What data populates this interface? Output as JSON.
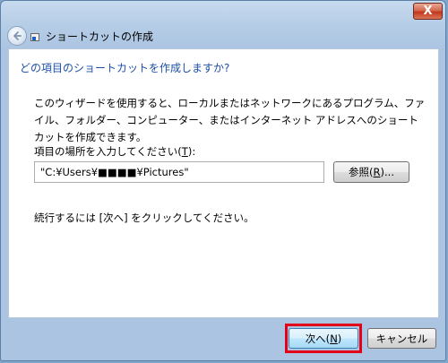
{
  "window": {
    "title": "ショートカットの作成",
    "close_glyph": "X"
  },
  "content": {
    "heading": "どの項目のショートカットを作成しますか?",
    "description": "このウィザードを使用すると、ローカルまたはネットワークにあるプログラム、ファイル、フォルダー、コンピューター、またはインターネット アドレスへのショートカットを作成できます。",
    "field_label_prefix": "項目の場所を入力してください(",
    "field_label_key": "T",
    "field_label_suffix": "):",
    "path_value": "\"C:¥Users¥■■■■¥Pictures\"",
    "browse_prefix": "参照(",
    "browse_key": "R",
    "browse_suffix": ")...",
    "hint": "続行するには [次へ] をクリックしてください。"
  },
  "buttons": {
    "next_prefix": "次へ(",
    "next_key": "N",
    "next_suffix": ")",
    "cancel": "キャンセル"
  },
  "colors": {
    "heading": "#1e4fa7",
    "highlight": "#e2001a"
  },
  "icons": {
    "back": "back-arrow-icon",
    "close": "close-icon",
    "wizard": "shortcut-wizard-icon"
  }
}
